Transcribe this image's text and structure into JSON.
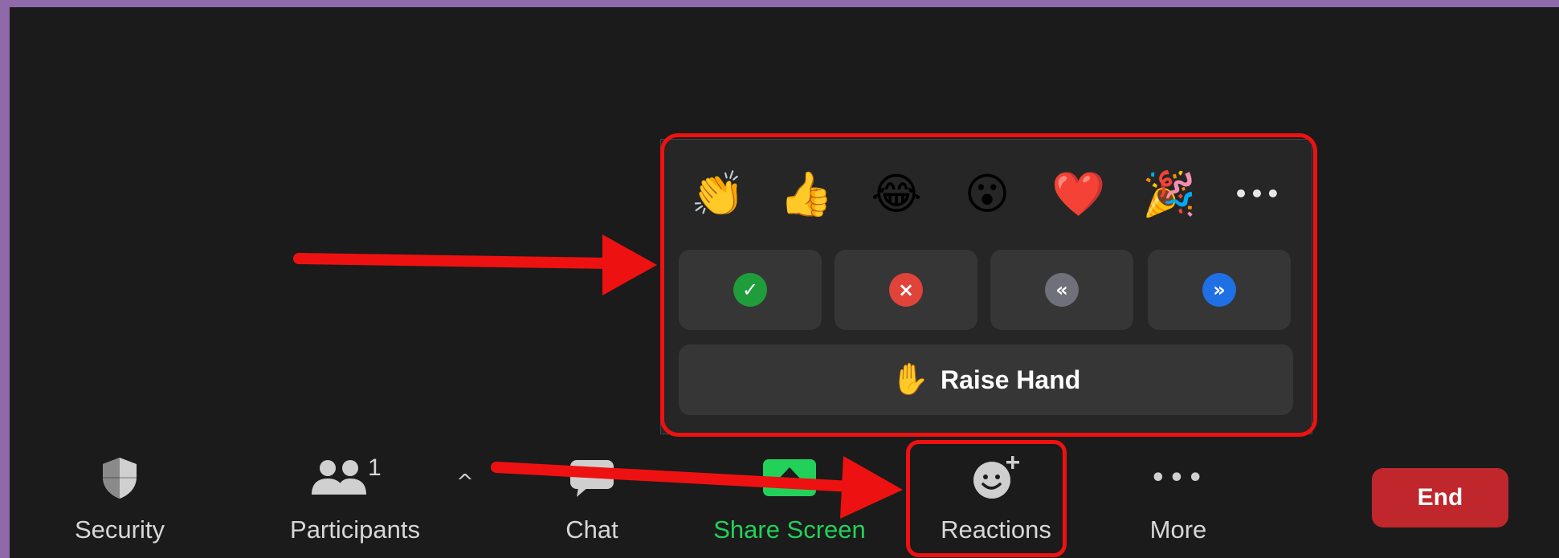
{
  "reactions_popup": {
    "emojis": [
      {
        "glyph": "👏",
        "name": "clap"
      },
      {
        "glyph": "👍",
        "name": "thumbs-up"
      },
      {
        "glyph": "😂",
        "name": "joy"
      },
      {
        "glyph": "😮",
        "name": "open-mouth"
      },
      {
        "glyph": "❤️",
        "name": "heart"
      },
      {
        "glyph": "🎉",
        "name": "tada"
      }
    ],
    "more_glyph": "•••",
    "status_buttons": [
      {
        "glyph": "✓",
        "name": "yes",
        "color": "#1f9d3a"
      },
      {
        "glyph": "×",
        "name": "no",
        "color": "#e0433a"
      },
      {
        "glyph": "«",
        "name": "slow-down",
        "color": "#70707a"
      },
      {
        "glyph": "»",
        "name": "speed-up",
        "color": "#1f6fe5"
      }
    ],
    "raise_hand": {
      "glyph": "✋",
      "label": "Raise Hand"
    }
  },
  "toolbar": {
    "security_label": "Security",
    "participants_label": "Participants",
    "participants_count": "1",
    "caret_glyph": "^",
    "chat_label": "Chat",
    "share_screen_label": "Share Screen",
    "reactions_label": "Reactions",
    "more_label": "More",
    "more_glyph": "•••",
    "end_label": "End"
  },
  "colors": {
    "frame": "#8f69a9",
    "background": "#1b1b1b",
    "popup": "#262626",
    "button": "#363636",
    "share_screen": "#22d15a",
    "end": "#c0272d",
    "annotation": "#ee1111"
  }
}
